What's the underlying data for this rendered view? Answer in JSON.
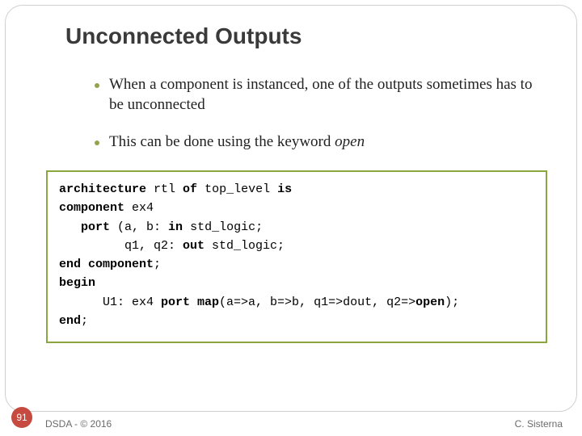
{
  "title": "Unconnected Outputs",
  "bullets": [
    {
      "text_a": "When a component is instanced, one of the outputs sometimes has to be unconnected"
    },
    {
      "text_a": "This can be done using the keyword ",
      "italic": "open"
    }
  ],
  "code": {
    "l1a": "architecture",
    "l1b": " rtl ",
    "l1c": "of",
    "l1d": " top_level ",
    "l1e": "is",
    "l2a": "component",
    "l2b": " ex4",
    "l3a": "   ",
    "l3b": "port",
    "l3c": " (a, b: ",
    "l3d": "in",
    "l3e": " std_logic;",
    "l4": "         q1, q2: ",
    "l4b": "out",
    "l4c": " std_logic;",
    "l5a": "end component",
    "l5b": ";",
    "l6": "begin",
    "l7a": "      U1: ex4 ",
    "l7b": "port map",
    "l7c": "(a=>a, b=>b, q1=>dout, q2=>",
    "l7d": "open",
    "l7e": ");",
    "l8a": "end",
    "l8b": ";"
  },
  "page_number": "91",
  "footer_left": "DSDA - © 2016",
  "footer_right": "C. Sisterna"
}
